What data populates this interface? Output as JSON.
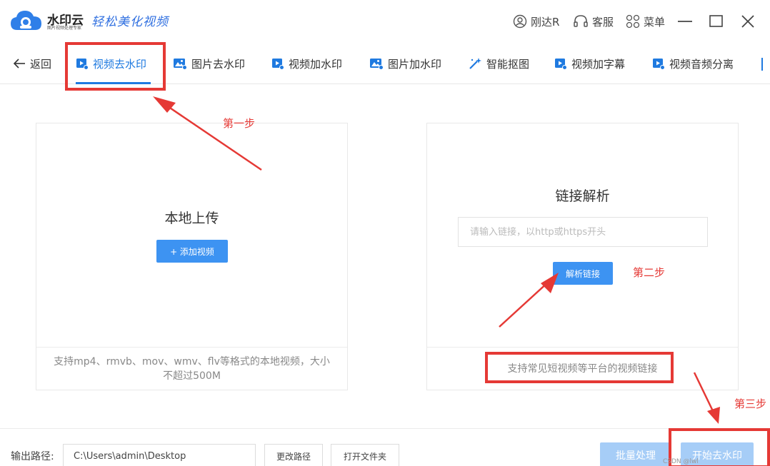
{
  "app": {
    "name": "水印云",
    "subtitle": "图片视频处理专家",
    "slogan": "轻松美化视频"
  },
  "titlebar": {
    "user": "刚达R",
    "service": "客服",
    "menu": "菜单"
  },
  "nav": {
    "back": "返回",
    "items": [
      {
        "label": "视频去水印",
        "icon": "video-icon"
      },
      {
        "label": "图片去水印",
        "icon": "image-icon"
      },
      {
        "label": "视频加水印",
        "icon": "video-icon"
      },
      {
        "label": "图片加水印",
        "icon": "image-icon"
      },
      {
        "label": "智能抠图",
        "icon": "magic-wand-icon"
      },
      {
        "label": "视频加字幕",
        "icon": "video-icon"
      },
      {
        "label": "视频音频分离",
        "icon": "video-icon"
      }
    ]
  },
  "local_card": {
    "title": "本地上传",
    "button": "+ 添加视频",
    "footer": "支持mp4、rmvb、mov、wmv、flv等格式的本地视频，大小不超过500M"
  },
  "link_card": {
    "title": "链接解析",
    "placeholder": "请输入链接，以http或https开头",
    "button": "解析链接",
    "footer": "支持常见短视频等平台的视频链接"
  },
  "bottom": {
    "output_label": "输出路径:",
    "output_path": "C:\\Users\\admin\\Desktop",
    "change_path": "更改路径",
    "open_folder": "打开文件夹",
    "batch": "批量处理",
    "start": "开始去水印"
  },
  "annotations": {
    "step1": "第一步",
    "step2": "第二步",
    "step3": "第三步",
    "color": "#e53935"
  },
  "colors": {
    "accent": "#1f7ae0",
    "button_blue": "#3d93f2",
    "button_light": "#a6cdf7"
  },
  "watermark": "CSDN @lwl"
}
